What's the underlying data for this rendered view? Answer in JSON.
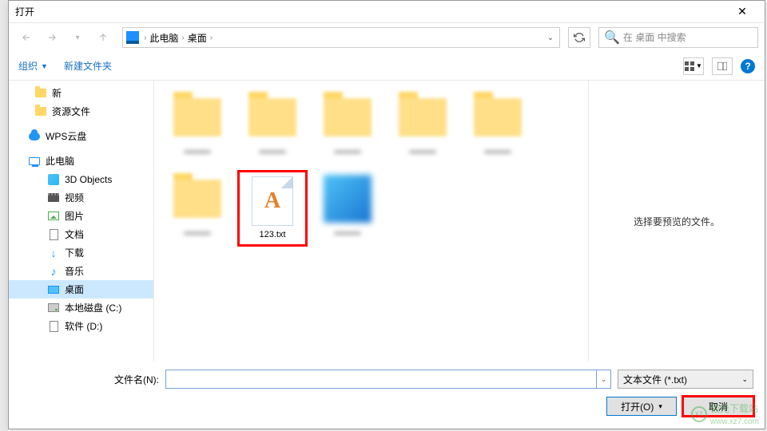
{
  "title": "打开",
  "nav": {
    "parts": [
      "此电脑",
      "桌面"
    ],
    "refresh_tip": "刷新"
  },
  "search": {
    "placeholder": "在 桌面 中搜索"
  },
  "toolbar": {
    "organize": "组织",
    "new_folder": "新建文件夹"
  },
  "sidebar": {
    "items": [
      {
        "label": "新",
        "icon": "folder",
        "indent": 1
      },
      {
        "label": "资源文件",
        "icon": "folder",
        "indent": 1
      },
      {
        "label": "WPS云盘",
        "icon": "cloud",
        "indent": 0
      },
      {
        "label": "此电脑",
        "icon": "pc",
        "indent": 0
      },
      {
        "label": "3D Objects",
        "icon": "3d",
        "indent": 1
      },
      {
        "label": "视频",
        "icon": "video",
        "indent": 1
      },
      {
        "label": "图片",
        "icon": "pic",
        "indent": 1
      },
      {
        "label": "文档",
        "icon": "doc",
        "indent": 1
      },
      {
        "label": "下载",
        "icon": "dl",
        "indent": 1
      },
      {
        "label": "音乐",
        "icon": "music",
        "indent": 1
      },
      {
        "label": "桌面",
        "icon": "desk",
        "indent": 1,
        "selected": true
      },
      {
        "label": "本地磁盘 (C:)",
        "icon": "disk",
        "indent": 1
      },
      {
        "label": "软件 (D:)",
        "icon": "disk",
        "indent": 1
      }
    ]
  },
  "files": {
    "txt_name": "123.txt",
    "folder_blur_label": "x2...."
  },
  "preview": {
    "empty": "选择要预览的文件。"
  },
  "footer": {
    "fname_label": "文件名(N):",
    "filter": "文本文件 (*.txt)",
    "open": "打开(O)",
    "cancel": "取消"
  },
  "watermark": {
    "text": "极光下载站",
    "url": "www.xz7.com"
  }
}
